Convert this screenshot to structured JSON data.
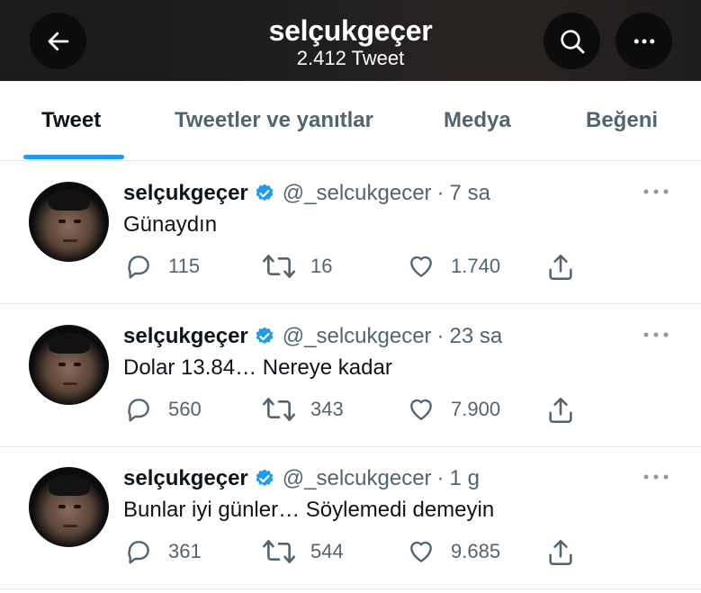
{
  "header": {
    "title": "selçukgeçer",
    "subtitle": "2.412 Tweet",
    "back_icon": "arrow-left-icon",
    "search_icon": "search-icon",
    "more_icon": "more-horizontal-icon"
  },
  "tabs": [
    {
      "label": "Tweet",
      "active": true
    },
    {
      "label": "Tweetler ve yanıtlar",
      "active": false
    },
    {
      "label": "Medya",
      "active": false
    },
    {
      "label": "Beğeni",
      "active": false
    }
  ],
  "colors": {
    "accent": "#1d9bf0",
    "muted": "#536471",
    "text": "#0f1419"
  },
  "tweets": [
    {
      "name": "selçukgeçer",
      "handle": "@_selcukgecer",
      "separator": "·",
      "time": "7 sa",
      "text": "Günaydın",
      "replies": "115",
      "retweets": "16",
      "likes": "1.740"
    },
    {
      "name": "selçukgeçer",
      "handle": "@_selcukgecer",
      "separator": "·",
      "time": "23 sa",
      "text": "Dolar 13.84… Nereye kadar",
      "replies": "560",
      "retweets": "343",
      "likes": "7.900"
    },
    {
      "name": "selçukgeçer",
      "handle": "@_selcukgecer",
      "separator": "·",
      "time": "1 g",
      "text": "Bunlar iyi günler… Söylemedi demeyin",
      "replies": "361",
      "retweets": "544",
      "likes": "9.685"
    }
  ]
}
